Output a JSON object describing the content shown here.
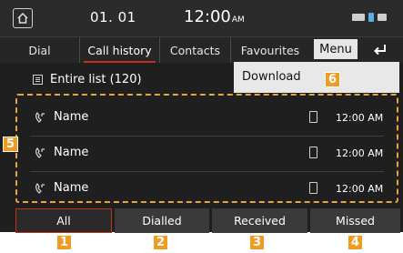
{
  "status": {
    "date": "01. 01",
    "time": "12:00",
    "ampm": "AM"
  },
  "tabs": [
    {
      "label": "Dial",
      "active": false
    },
    {
      "label": "Call history",
      "active": true
    },
    {
      "label": "Contacts",
      "active": false
    },
    {
      "label": "Favourites",
      "active": false
    }
  ],
  "menu": {
    "label": "Menu"
  },
  "list_header": {
    "label": "Entire list (120)"
  },
  "dropdown": {
    "items": [
      {
        "label": "Download"
      }
    ]
  },
  "rows": [
    {
      "name": "Name",
      "time": "12:00 AM"
    },
    {
      "name": "Name",
      "time": "12:00 AM"
    },
    {
      "name": "Name",
      "time": "12:00 AM"
    }
  ],
  "filters": [
    {
      "label": "All",
      "active": true
    },
    {
      "label": "Dialled",
      "active": false
    },
    {
      "label": "Received",
      "active": false
    },
    {
      "label": "Missed",
      "active": false
    }
  ],
  "badges": [
    "1",
    "2",
    "3",
    "4",
    "5",
    "6"
  ],
  "colors": {
    "accent": "#c4301c",
    "badge": "#f29b22",
    "background": "#1f1f1f"
  }
}
